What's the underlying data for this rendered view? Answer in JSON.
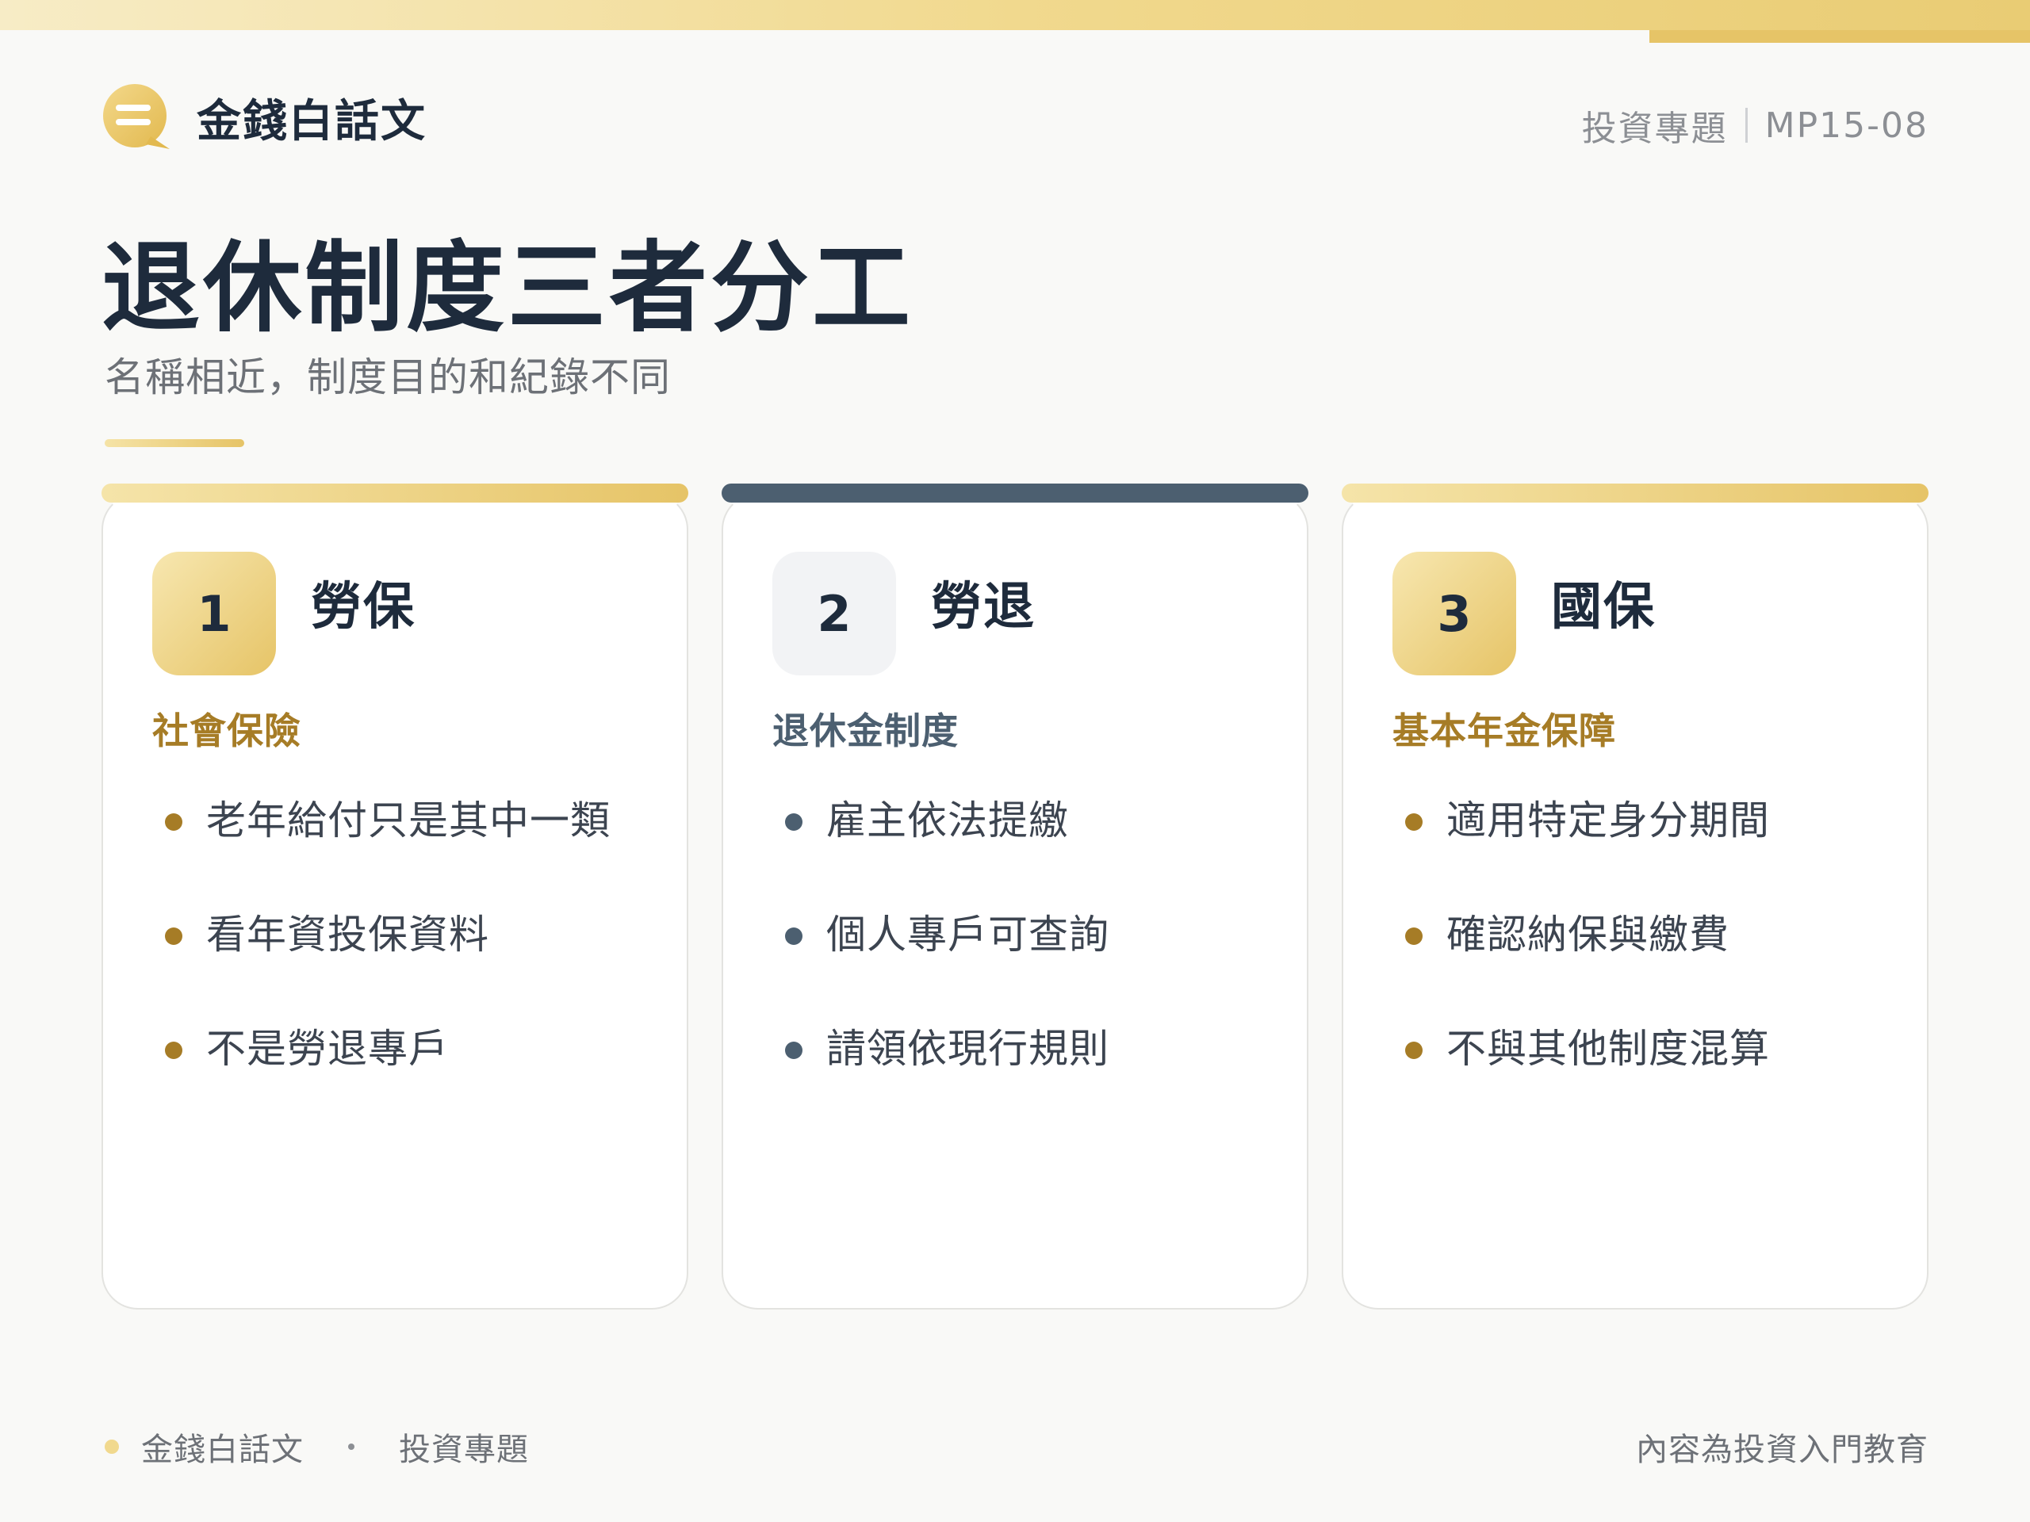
{
  "brand": {
    "name": "金錢白話文"
  },
  "header": {
    "category": "投資專題",
    "code": "MP15-08"
  },
  "page": {
    "title": "退休制度三者分工",
    "subtitle": "名稱相近，制度目的和紀錄不同"
  },
  "colors": {
    "gold": "#e6c467",
    "gold_text": "#a67c26",
    "slate": "#4c5f70",
    "navy": "#1e2b3c"
  },
  "cards": [
    {
      "number": "1",
      "title": "勞保",
      "subtitle": "社會保險",
      "items": [
        "老年給付只是其中一類",
        "看年資投保資料",
        "不是勞退專戶"
      ]
    },
    {
      "number": "2",
      "title": "勞退",
      "subtitle": "退休金制度",
      "items": [
        "雇主依法提繳",
        "個人專戶可查詢",
        "請領依現行規則"
      ]
    },
    {
      "number": "3",
      "title": "國保",
      "subtitle": "基本年金保障",
      "items": [
        "適用特定身分期間",
        "確認納保與繳費",
        "不與其他制度混算"
      ]
    }
  ],
  "footer": {
    "brand": "金錢白話文",
    "category": "投資專題",
    "note": "內容為投資入門教育"
  }
}
